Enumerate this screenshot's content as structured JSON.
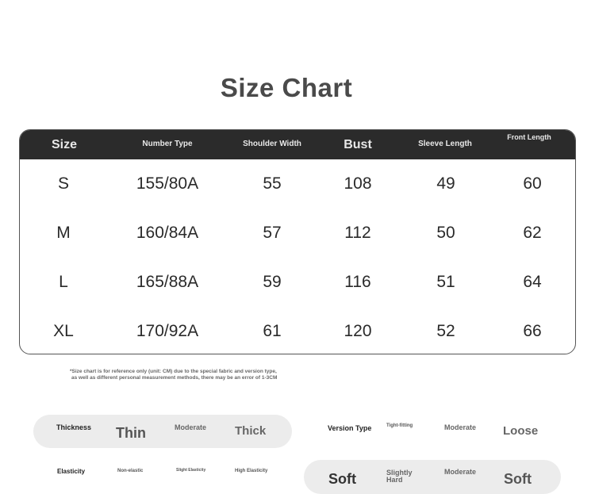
{
  "title": "Size Chart",
  "table": {
    "headers": [
      "Size",
      "Number Type",
      "Shoulder Width",
      "Bust",
      "Sleeve Length",
      "Front Length"
    ],
    "rows": [
      [
        "S",
        "155/80A",
        "55",
        "108",
        "49",
        "60"
      ],
      [
        "M",
        "160/84A",
        "57",
        "112",
        "50",
        "62"
      ],
      [
        "L",
        "165/88A",
        "59",
        "116",
        "51",
        "64"
      ],
      [
        "XL",
        "170/92A",
        "61",
        "120",
        "52",
        "66"
      ]
    ]
  },
  "note": {
    "line1": "*Size chart is for reference only (unit: CM) due to the special fabric and version type,",
    "line2": "as well as different personal measurement methods, there may be an error of 1-3CM"
  },
  "thickness": {
    "label": "Thickness",
    "options": [
      "Thin",
      "Moderate",
      "Thick"
    ],
    "selected": "Thin"
  },
  "version": {
    "label": "Version Type",
    "options": [
      "Tight-fitting",
      "Moderate",
      "Loose"
    ],
    "selected": "Loose"
  },
  "elasticity": {
    "label": "Elasticity",
    "options": [
      "Non-elastic",
      "Slight Elasticity",
      "High Elasticity"
    ]
  },
  "softness": {
    "options": [
      "Soft",
      "Slightly Hard",
      "Moderate",
      "Soft"
    ]
  }
}
